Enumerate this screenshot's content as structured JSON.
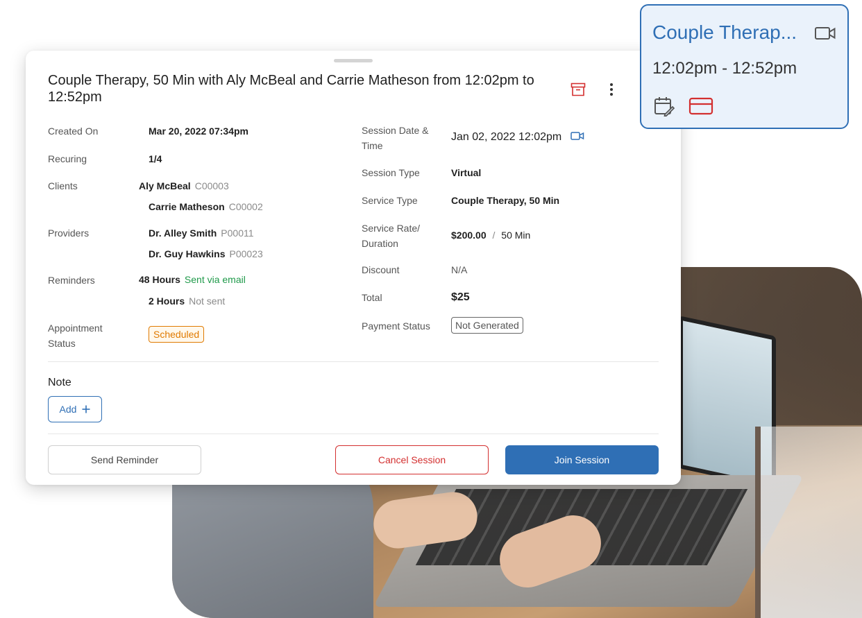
{
  "appointment": {
    "title": "Couple Therapy, 50 Min with Aly McBeal and Carrie Matheson from 12:02pm to 12:52pm",
    "left": {
      "created_on_label": "Created On",
      "created_on_value": "Mar 20, 2022 07:34pm",
      "recurring_label": "Recuring",
      "recurring_value": "1/4",
      "clients_label": "Clients",
      "clients": [
        {
          "name": "Aly McBeal",
          "id": "C00003"
        },
        {
          "name": "Carrie Matheson",
          "id": "C00002"
        }
      ],
      "providers_label": "Providers",
      "providers": [
        {
          "name": "Dr. Alley Smith",
          "id": "P00011"
        },
        {
          "name": "Dr. Guy Hawkins",
          "id": "P00023"
        }
      ],
      "reminders_label": "Reminders",
      "reminders": [
        {
          "time": "48 Hours",
          "status": "Sent via email"
        },
        {
          "time": "2 Hours",
          "status": "Not sent"
        }
      ],
      "status_label_line1": "Appointment",
      "status_label_line2": "Status",
      "status_value": "Scheduled"
    },
    "right": {
      "date_label_line1": "Session Date &",
      "date_label_line2": "Time",
      "date_value": "Jan 02, 2022 12:02pm",
      "type_label": "Session Type",
      "type_value": "Virtual",
      "service_label": "Service Type",
      "service_value": "Couple Therapy, 50 Min",
      "rate_label_line1": "Service Rate/",
      "rate_label_line2": "Duration",
      "rate_amount": "$200.00",
      "rate_separator": "/",
      "rate_duration": "50 Min",
      "discount_label": "Discount",
      "discount_value": "N/A",
      "total_label": "Total",
      "total_value": "$25",
      "payment_label": "Payment Status",
      "payment_value": "Not Generated"
    },
    "note": {
      "title": "Note",
      "add_label": "Add"
    },
    "actions": {
      "send_reminder": "Send Reminder",
      "cancel_session": "Cancel Session",
      "join_session": "Join Session"
    }
  },
  "mini_card": {
    "title": "Couple Therap...",
    "time": "12:02pm - 12:52pm"
  },
  "colors": {
    "primary": "#2f6fb5",
    "danger": "#d32f2f",
    "success": "#1f9a4a",
    "warning": "#e07a00"
  },
  "icons": [
    "archive-icon",
    "more-vert-icon",
    "video-icon",
    "plus-icon",
    "calendar-edit-icon",
    "credit-card-icon"
  ]
}
